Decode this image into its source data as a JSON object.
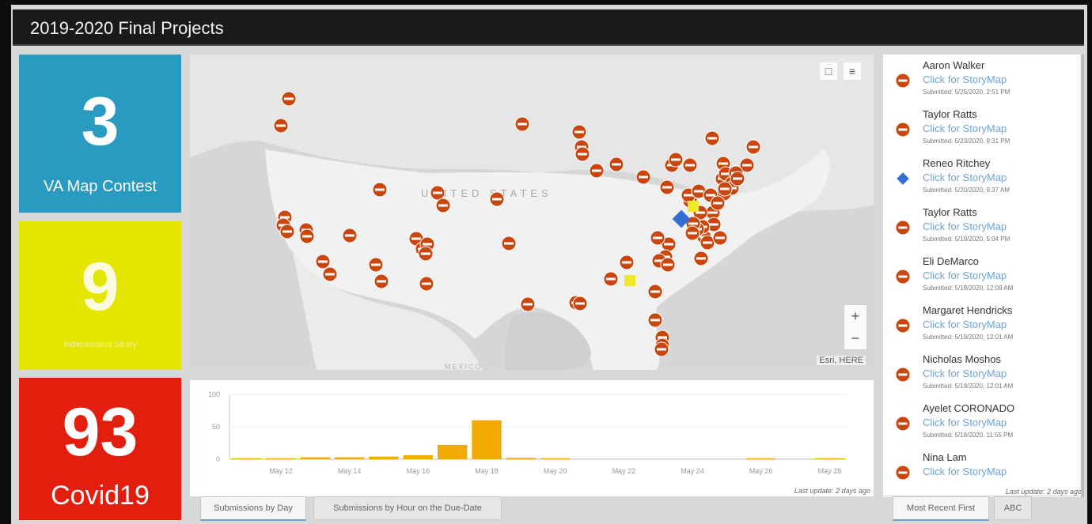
{
  "header": {
    "title": "2019-2020 Final Projects"
  },
  "tiles": [
    {
      "value": "3",
      "caption": "VA Map Contest",
      "color": "#2a9bc0"
    },
    {
      "value": "9",
      "caption": "Independent Study",
      "color": "#e5e600"
    },
    {
      "value": "93",
      "caption": "Covid19",
      "color": "#e31e0f"
    }
  ],
  "map": {
    "country_label": "UNITED STATES",
    "mexico_label": "MEXICO",
    "attribution": "Esri, HERE",
    "zoom_in": "+",
    "zoom_out": "−",
    "bookmark_icon": "bookmark-icon",
    "legend_icon": "legend-list-icon",
    "marker_colors": {
      "covid": "#c9460f",
      "va_contest": "#2f6fd6",
      "independent": "#f0e82a"
    }
  },
  "chart_panel": {
    "last_update": "Last update: 2 days ago"
  },
  "chart_data": {
    "type": "bar",
    "categories": [
      "May 11",
      "May 12",
      "May 13",
      "May 14",
      "May 15",
      "May 16",
      "May 17",
      "May 18",
      "May 19",
      "May 20",
      "May 21",
      "May 22",
      "May 23",
      "May 24",
      "May 25",
      "May 26",
      "May 27",
      "May 28"
    ],
    "tick_labels": [
      "May 12",
      "May 14",
      "May 16",
      "May 18",
      "May 20",
      "May 22",
      "May 24",
      "May 26",
      "May 28"
    ],
    "values": [
      1,
      1,
      3,
      3,
      4,
      6,
      22,
      60,
      2,
      1,
      0,
      0,
      0,
      0,
      0,
      1,
      0,
      1
    ],
    "yticks": [
      0,
      50,
      100
    ],
    "ylim": [
      0,
      100
    ],
    "bar_color": "#f2a900",
    "title": "",
    "xlabel": "",
    "ylabel": ""
  },
  "chart_tabs": [
    {
      "label": "Submissions by Day",
      "active": true
    },
    {
      "label": "Submissions by Hour on the Due-Date",
      "active": false
    }
  ],
  "list": {
    "link_text": "Click for StoryMap",
    "items": [
      {
        "name": "Aaron Walker",
        "date": "Submitted: 5/25/2020, 2:51 PM",
        "icon": "covid"
      },
      {
        "name": "Taylor Ratts",
        "date": "Submitted: 5/23/2020, 9:31 PM",
        "icon": "covid"
      },
      {
        "name": "Reneo Ritchey",
        "date": "Submitted: 5/20/2020, 9:37 AM",
        "icon": "va"
      },
      {
        "name": "Taylor Ratts",
        "date": "Submitted: 5/19/2020, 5:04 PM",
        "icon": "covid"
      },
      {
        "name": "Eli DeMarco",
        "date": "Submitted: 5/19/2020, 12:09 AM",
        "icon": "covid"
      },
      {
        "name": "Margaret Hendricks",
        "date": "Submitted: 5/19/2020, 12:01 AM",
        "icon": "covid"
      },
      {
        "name": "Nicholas Moshos",
        "date": "Submitted: 5/19/2020, 12:01 AM",
        "icon": "covid"
      },
      {
        "name": "Ayelet CORONADO",
        "date": "Submitted: 5/18/2020, 11:55 PM",
        "icon": "covid"
      },
      {
        "name": "Nina Lam",
        "date": "",
        "icon": "covid"
      }
    ],
    "last_update": "Last update: 2 days ago"
  },
  "list_tabs": [
    {
      "label": "Most Recent First",
      "active": true
    },
    {
      "label": "ABC",
      "active": false
    }
  ]
}
